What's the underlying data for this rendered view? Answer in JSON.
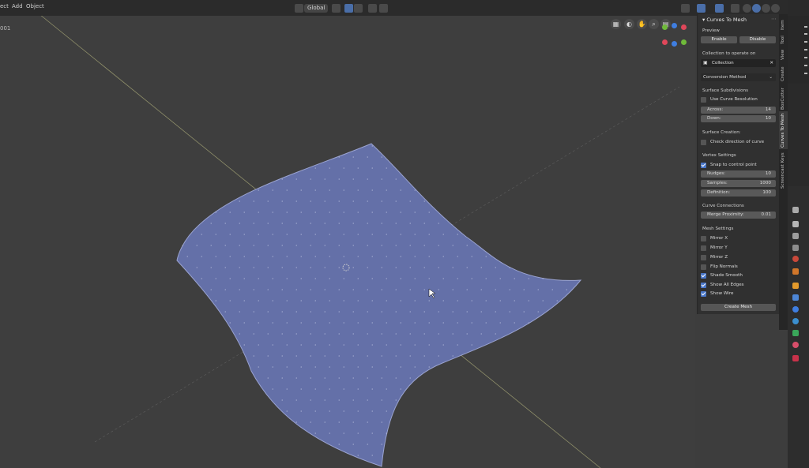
{
  "header": {
    "menus": [
      "ect",
      "Add",
      "Object"
    ],
    "frame_label": "001",
    "orientation": "Global"
  },
  "colors": {
    "mesh_fill": "#6470a8",
    "viewport_bg": "#3e3e3e",
    "panel_bg": "#303030",
    "axis_x": "#e0475a",
    "axis_y": "#6fba3a",
    "axis_z": "#3f7ee0",
    "accent": "#4a77c9"
  },
  "npanel": {
    "title": "Curves To Mesh",
    "preview": {
      "label": "Preview",
      "enable": "Enable",
      "disable": "Disable"
    },
    "collection": {
      "label": "Collection to operate on",
      "value": "Collection"
    },
    "conversion": {
      "label": "Conversion Method"
    },
    "surface_subdiv": {
      "label": "Surface Subdivisions",
      "use_curve_res": "Use Curve Resolution",
      "across_label": "Across:",
      "across_value": "14",
      "down_label": "Down:",
      "down_value": "10"
    },
    "surface_creation": {
      "label": "Surface Creation:",
      "check_dir": "Check direction of curve"
    },
    "vertex": {
      "label": "Vertex Settings",
      "snap": "Snap to control point",
      "nudges_label": "Nudges:",
      "nudges_value": "10",
      "samples_label": "Samples:",
      "samples_value": "1000",
      "definition_label": "Definition:",
      "definition_value": "100"
    },
    "connections": {
      "label": "Curve Connections",
      "merge_label": "Merge Proximity:",
      "merge_value": "0.01"
    },
    "mesh": {
      "label": "Mesh Settings",
      "mirror_x": "Mirror X",
      "mirror_y": "Mirror Y",
      "mirror_z": "Mirror Z",
      "flip": "Flip Normals",
      "smooth": "Shade Smooth",
      "all_edges": "Show All Edges",
      "wire": "Show Wire"
    },
    "create_button": "Create Mesh"
  },
  "sidebar_tabs": [
    "Item",
    "Tool",
    "View",
    "Create",
    "BoxCutter",
    "Curves To Mesh",
    "Screencast Keys"
  ]
}
